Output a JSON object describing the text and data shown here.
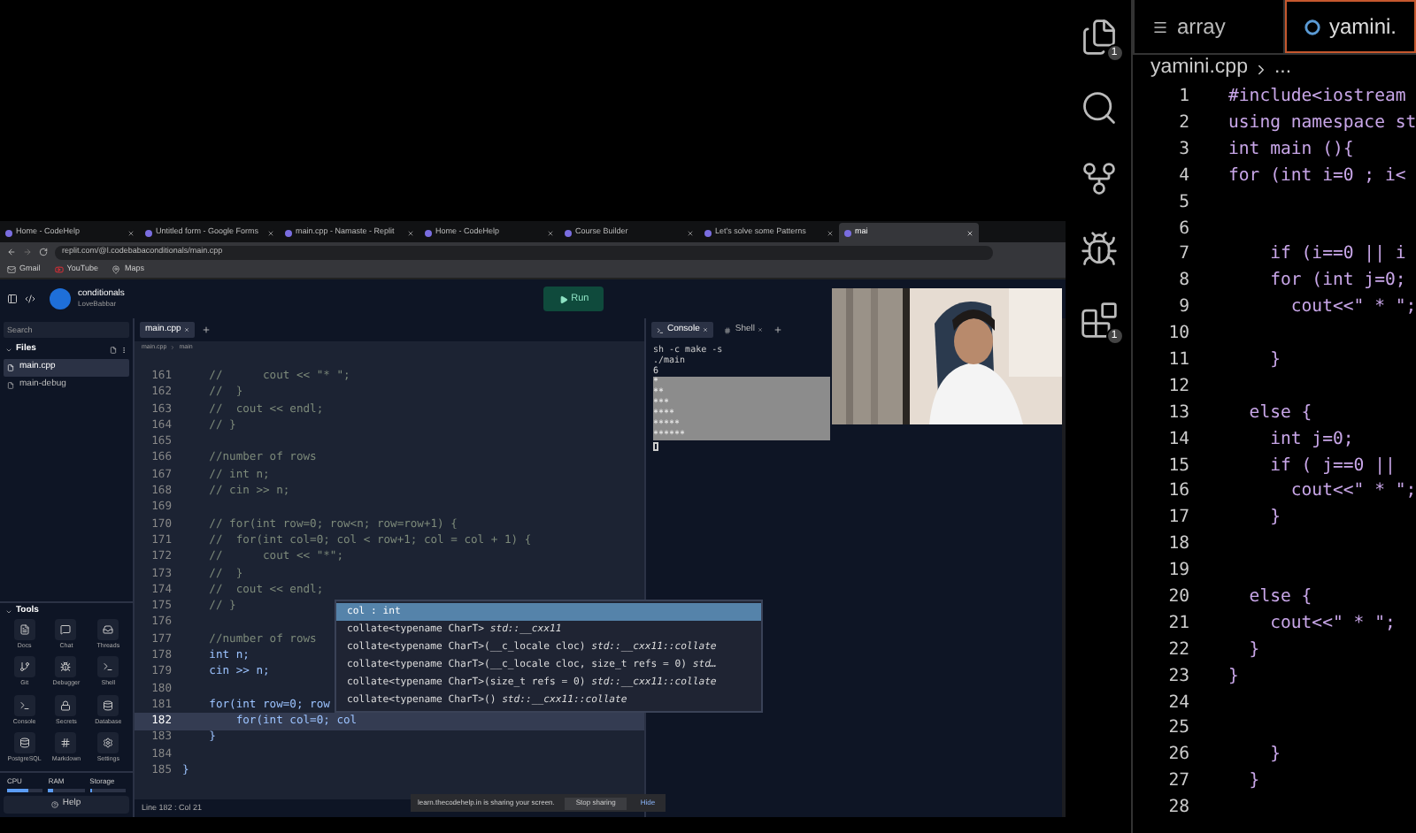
{
  "browser": {
    "tabs": [
      {
        "title": "Home - CodeHelp",
        "selected": false
      },
      {
        "title": "Untitled form - Google Forms",
        "selected": false
      },
      {
        "title": "main.cpp - Namaste - Replit",
        "selected": false
      },
      {
        "title": "Home - CodeHelp",
        "selected": false
      },
      {
        "title": "Course Builder",
        "selected": false
      },
      {
        "title": "Let's solve some Patterns",
        "selected": false
      },
      {
        "title": "mai",
        "selected": true
      }
    ],
    "url": "replit.com/@l.codebabaconditionals/main.cpp",
    "bookmarks": [
      "Gmail",
      "YouTube",
      "Maps"
    ],
    "share_notice": {
      "text": "learn.thecodehelp.in is sharing your screen.",
      "stop": "Stop sharing",
      "hide": "Hide"
    }
  },
  "replit": {
    "repl_name": "conditionals",
    "owner": "LoveBabbar",
    "run": "Run",
    "search_placeholder": "Search",
    "files_title": "Files",
    "files": [
      {
        "name": "main.cpp",
        "selected": true
      },
      {
        "name": "main-debug",
        "selected": false
      }
    ],
    "tools_title": "Tools",
    "tools": [
      "Docs",
      "Chat",
      "Threads",
      "Git",
      "Debugger",
      "Shell",
      "Console",
      "Secrets",
      "Database",
      "PostgreSQL",
      "Markdown",
      "Settings"
    ],
    "meters": [
      {
        "label": "CPU",
        "level": 0.6
      },
      {
        "label": "RAM",
        "level": 0.15
      },
      {
        "label": "Storage",
        "level": 0.04
      }
    ],
    "help": "Help",
    "editor_tab": "main.cpp",
    "breadcrumb": [
      "main.cpp",
      "main"
    ],
    "lines": [
      {
        "number": "161",
        "text": "    //      cout << \"* \";",
        "kind": "comment",
        "selected": false
      },
      {
        "number": "162",
        "text": "    //  }",
        "kind": "comment",
        "selected": false
      },
      {
        "number": "163",
        "text": "    //  cout << endl;",
        "kind": "comment",
        "selected": false
      },
      {
        "number": "164",
        "text": "    // }",
        "kind": "comment",
        "selected": false
      },
      {
        "number": "165",
        "selected": false
      },
      {
        "number": "166",
        "text": "    //number of rows",
        "kind": "comment",
        "selected": false
      },
      {
        "number": "167",
        "text": "    // int n;",
        "kind": "comment",
        "selected": false
      },
      {
        "number": "168",
        "text": "    // cin >> n;",
        "kind": "comment",
        "selected": false
      },
      {
        "number": "169",
        "selected": false
      },
      {
        "number": "170",
        "text": "    // for(int row=0; row<n; row=row+1) {",
        "kind": "comment",
        "selected": false
      },
      {
        "number": "171",
        "text": "    //  for(int col=0; col < row+1; col = col + 1) {",
        "kind": "comment",
        "selected": false
      },
      {
        "number": "172",
        "text": "    //      cout << \"*\";",
        "kind": "comment",
        "selected": false
      },
      {
        "number": "173",
        "text": "    //  }",
        "kind": "comment",
        "selected": false
      },
      {
        "number": "174",
        "text": "    //  cout << endl;",
        "kind": "comment",
        "selected": false
      },
      {
        "number": "175",
        "text": "    // }",
        "kind": "comment",
        "selected": false
      },
      {
        "number": "176",
        "selected": false
      },
      {
        "number": "177",
        "text": "    //number of rows",
        "kind": "comment",
        "selected": false
      },
      {
        "number": "178",
        "text": "    int n;",
        "kind": "code",
        "selected": false
      },
      {
        "number": "179",
        "text": "    cin >> n;",
        "kind": "code",
        "selected": false
      },
      {
        "number": "180",
        "selected": false
      },
      {
        "number": "181",
        "text": "    for(int row=0; row",
        "kind": "code",
        "selected": false
      },
      {
        "number": "182",
        "text": "        for(int col=0; col",
        "kind": "code",
        "selected": true
      },
      {
        "number": "183",
        "text": "    }",
        "kind": "code",
        "selected": false
      },
      {
        "number": "184",
        "selected": false
      },
      {
        "number": "185",
        "text": "}",
        "kind": "code",
        "selected": false
      }
    ],
    "suggestions": [
      {
        "text": "col : int",
        "selected": true
      },
      {
        "text": "collate<typename CharT> *std::__cxx11*",
        "selected": false
      },
      {
        "text": "collate<typename CharT>(__c_locale cloc) *std::__cxx11::collate*",
        "selected": false
      },
      {
        "text": "collate<typename CharT>(__c_locale cloc, size_t refs = 0) *std…*",
        "selected": false
      },
      {
        "text": "collate<typename CharT>(size_t refs = 0) *std::__cxx11::collate*",
        "selected": false
      },
      {
        "text": "collate<typename CharT>() *std::__cxx11::collate*",
        "selected": false
      }
    ],
    "status": "Line 182 : Col 21",
    "pane_tabs": [
      {
        "label": "Console",
        "selected": true
      },
      {
        "label": "Shell",
        "selected": false
      }
    ],
    "console_commands": [
      "sh -c make -s",
      "./main"
    ],
    "console_input": "6",
    "console_output": [
      "*",
      "**",
      "***",
      "****",
      "*****",
      "******"
    ]
  },
  "vscode": {
    "tabs": [
      {
        "label": "array",
        "selected": false
      },
      {
        "label": "yamini.",
        "selected": true
      }
    ],
    "breadcrumb": [
      "yamini.cpp",
      "..."
    ],
    "badges": [
      "1",
      "1"
    ],
    "lines": [
      {
        "number": "1",
        "text": "#include<iostream"
      },
      {
        "number": "2",
        "text": "using namespace st"
      },
      {
        "number": "3",
        "text": "int main (){"
      },
      {
        "number": "4",
        "text": "for (int i=0 ; i<"
      },
      {
        "number": "5"
      },
      {
        "number": "6"
      },
      {
        "number": "7",
        "text": "    if (i==0 || i"
      },
      {
        "number": "8",
        "text": "    for (int j=0;"
      },
      {
        "number": "9",
        "text": "      cout<<\" * \";"
      },
      {
        "number": "10"
      },
      {
        "number": "11",
        "text": "    }"
      },
      {
        "number": "12"
      },
      {
        "number": "13",
        "text": "  else {"
      },
      {
        "number": "14",
        "text": "    int j=0;"
      },
      {
        "number": "15",
        "text": "    if ( j==0 ||"
      },
      {
        "number": "16",
        "text": "      cout<<\" * \";"
      },
      {
        "number": "17",
        "text": "    }"
      },
      {
        "number": "18"
      },
      {
        "number": "19"
      },
      {
        "number": "20",
        "text": "  else {"
      },
      {
        "number": "21",
        "text": "    cout<<\" * \";"
      },
      {
        "number": "22",
        "text": "  }"
      },
      {
        "number": "23",
        "text": "}"
      },
      {
        "number": "24"
      },
      {
        "number": "25"
      },
      {
        "number": "26",
        "text": "    }"
      },
      {
        "number": "27",
        "text": "  }"
      },
      {
        "number": "28"
      }
    ]
  }
}
